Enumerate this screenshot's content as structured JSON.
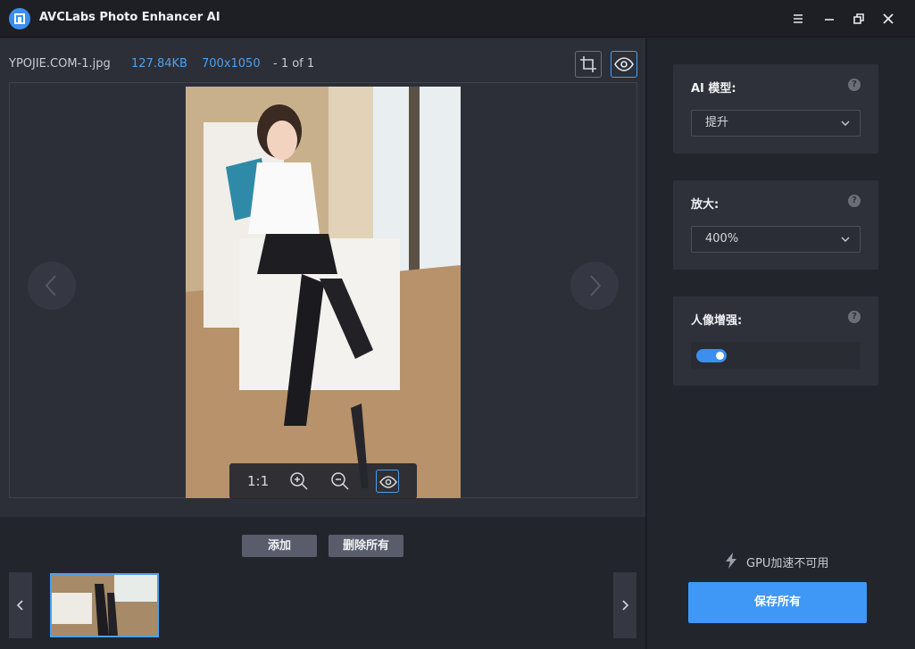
{
  "app": {
    "title": "AVCLabs Photo Enhancer AI"
  },
  "file": {
    "name": "YPOJIE.COM-1.jpg",
    "size": "127.84KB",
    "dimensions": "700x1050",
    "page": "- 1 of 1"
  },
  "zoom": {
    "actual_size_label": "1:1"
  },
  "actions": {
    "add_label": "添加",
    "delete_all_label": "删除所有",
    "save_all_label": "保存所有"
  },
  "settings": {
    "ai_model": {
      "label": "AI 模型:",
      "value": "提升"
    },
    "upscale": {
      "label": "放大:",
      "value": "400%"
    },
    "face_enhance": {
      "label": "人像增强:",
      "enabled": true
    }
  },
  "gpu": {
    "status": "GPU加速不可用"
  },
  "colors": {
    "accent": "#3f98f5",
    "background": "#23252c",
    "panel": "#2e3139"
  }
}
